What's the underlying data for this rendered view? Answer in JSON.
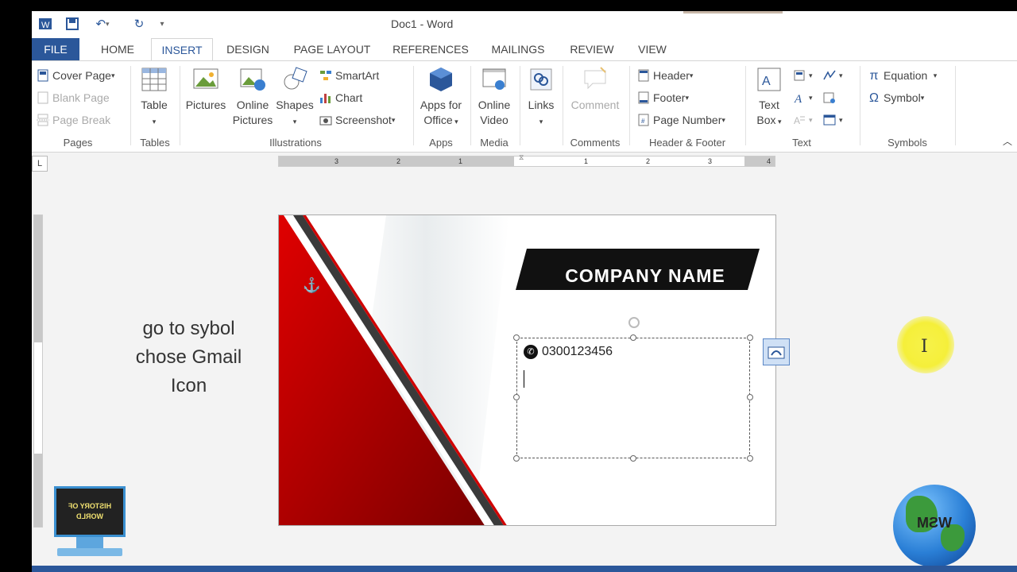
{
  "window": {
    "title": "Doc1 - Word"
  },
  "quick_access": {
    "save": "save-icon",
    "undo": "undo-icon",
    "redo": "redo-icon",
    "customize": "▾"
  },
  "tabs": [
    {
      "label": "FILE"
    },
    {
      "label": "HOME"
    },
    {
      "label": "INSERT"
    },
    {
      "label": "DESIGN"
    },
    {
      "label": "PAGE LAYOUT"
    },
    {
      "label": "REFERENCES"
    },
    {
      "label": "MAILINGS"
    },
    {
      "label": "REVIEW"
    },
    {
      "label": "VIEW"
    }
  ],
  "ribbon": {
    "pages": {
      "label": "Pages",
      "cover_page": "Cover Page",
      "blank_page": "Blank Page",
      "page_break": "Page Break"
    },
    "tables": {
      "label": "Tables",
      "table": "Table"
    },
    "illustrations": {
      "label": "Illustrations",
      "pictures": "Pictures",
      "online_pictures_1": "Online",
      "online_pictures_2": "Pictures",
      "shapes": "Shapes",
      "smartart": "SmartArt",
      "chart": "Chart",
      "screenshot": "Screenshot"
    },
    "apps": {
      "label": "Apps",
      "apps_for_office_1": "Apps for",
      "apps_for_office_2": "Office"
    },
    "media": {
      "label": "Media",
      "online_video_1": "Online",
      "online_video_2": "Video"
    },
    "links": {
      "label": "Links"
    },
    "comments": {
      "label": "Comments",
      "comment": "Comment"
    },
    "header_footer": {
      "label": "Header & Footer",
      "header": "Header",
      "footer": "Footer",
      "page_number": "Page Number"
    },
    "text": {
      "label": "Text",
      "text_box_1": "Text",
      "text_box_2": "Box"
    },
    "symbols": {
      "label": "Symbols",
      "equation": "Equation",
      "symbol": "Symbol"
    }
  },
  "ruler": {
    "corner": "L",
    "numbers_left": [
      "3",
      "2",
      "1"
    ],
    "numbers_right": [
      "1",
      "2",
      "3",
      "4"
    ]
  },
  "document": {
    "company_name": "COMPANY NAME",
    "phone": "0300123456",
    "colors": {
      "red": "#c00000",
      "dark": "#1a1a1a"
    }
  },
  "overlay": {
    "hint_lines": [
      "go to sybol",
      "chose Gmail",
      "Icon"
    ],
    "logo_left_text": "HISTORY OF WORLD",
    "logo_right_text": "WSM"
  }
}
